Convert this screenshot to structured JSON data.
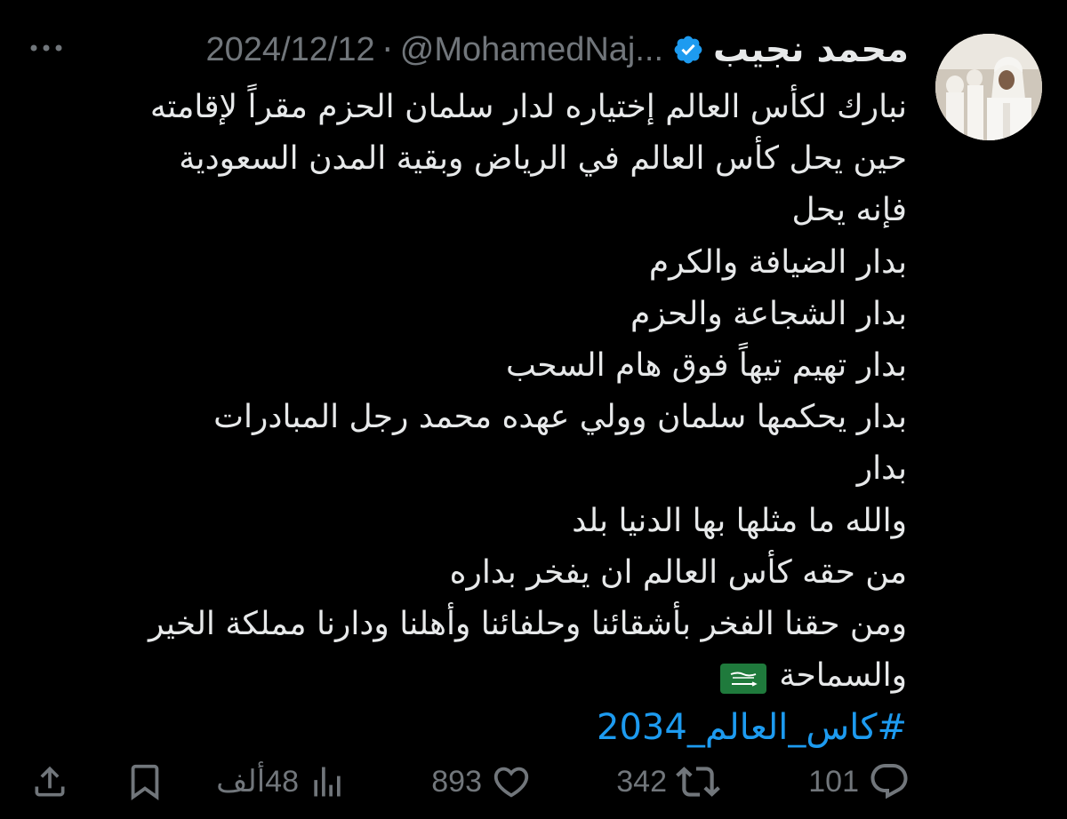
{
  "author": {
    "display_name": "محمد نجيب",
    "verified_icon": "verified-badge-icon",
    "handle": "@MohamedNaj...",
    "date": "2024/12/12",
    "separator": "·"
  },
  "tweet": {
    "lines": [
      "نبارك لكأس العالم إختياره لدار سلمان الحزم  مقراً  لإقامته",
      "حين يحل كأس العالم في الرياض وبقية المدن السعودية",
      "فإنه يحل",
      "بدار الضيافة والكرم",
      "بدار الشجاعة والحزم",
      "بدار تهيم تيهاً فوق هام السحب",
      "بدار يحكمها سلمان وولي عهده محمد رجل المبادرات",
      "بدار",
      "والله ما مثلها بها الدنيا بلد",
      "من حقه  كأس العالم ان يفخر بداره",
      "ومن حقنا الفخر بأشقائنا وحلفائنا وأهلنا ودارنا مملكة الخير",
      "والسماحة"
    ],
    "flag_icon": "saudi-flag-icon",
    "hashtag": "#كاس_العالم_2034"
  },
  "actions": {
    "replies": "101",
    "retweets": "342",
    "likes": "893",
    "views": "48ألف"
  },
  "icons": {
    "more": "more-icon",
    "reply": "reply-icon",
    "retweet": "retweet-icon",
    "like": "heart-icon",
    "views": "views-chart-icon",
    "bookmark": "bookmark-icon",
    "share": "share-icon"
  },
  "colors": {
    "background": "#000000",
    "text": "#e7e9ea",
    "muted": "#71767b",
    "link": "#1d9bf0",
    "verified": "#1d9bf0"
  }
}
